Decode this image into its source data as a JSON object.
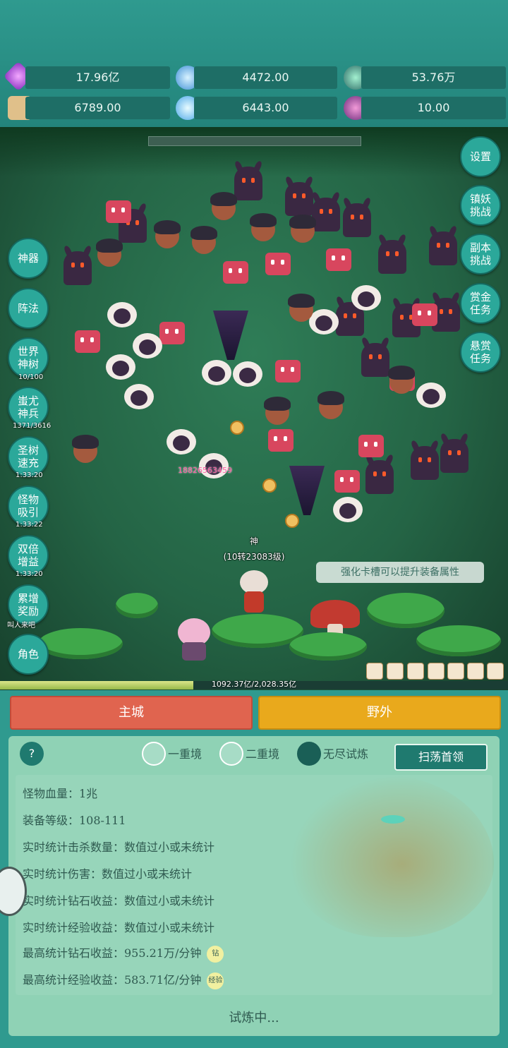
{
  "resources": [
    {
      "icon": "purple-gem-icon",
      "value": "17.96亿"
    },
    {
      "icon": "blue-crystal-icon",
      "value": "4472.00"
    },
    {
      "icon": "green-orb-icon",
      "value": "53.76万"
    },
    {
      "icon": "scroll-icon",
      "value": "6789.00"
    },
    {
      "icon": "ice-crystal-icon",
      "value": "6443.00"
    },
    {
      "icon": "purple-pouch-icon",
      "value": "10.00"
    }
  ],
  "left_menu": [
    {
      "label": "神器",
      "sub": ""
    },
    {
      "label": "阵法",
      "sub": ""
    },
    {
      "label": "世界神树",
      "sub": "10/100"
    },
    {
      "label": "蚩尤神兵",
      "sub": "1371/3616"
    },
    {
      "label": "圣树速充",
      "sub": "1:33:20"
    },
    {
      "label": "怪物吸引",
      "sub": "1:33:22"
    },
    {
      "label": "双倍增益",
      "sub": "1:33:20"
    },
    {
      "label": "累增奖励",
      "sub": "叫人来吧"
    },
    {
      "label": "角色",
      "sub": ""
    }
  ],
  "right_menu": [
    {
      "label": "设置"
    },
    {
      "label": "镇妖挑战"
    },
    {
      "label": "副本挑战"
    },
    {
      "label": "赏金任务"
    },
    {
      "label": "悬赏任务"
    }
  ],
  "battle": {
    "damage_text": "18826563459",
    "hero_name": "神",
    "hero_level": "(10转23083级)",
    "hint": "强化卡槽可以提升装备属性",
    "boss_hp": "1092.37亿/2,028.35亿"
  },
  "nav": {
    "main_city": "主城",
    "wild": "野外"
  },
  "panel": {
    "help": "?",
    "modes": [
      "一重境",
      "二重境",
      "无尽试炼"
    ],
    "selected_mode": "无尽试炼",
    "sweep_label": "扫荡首领",
    "stats": [
      {
        "text": "怪物血量：1兆",
        "tag": ""
      },
      {
        "text": "装备等级：108-111",
        "tag": ""
      },
      {
        "text": "实时统计击杀数量：数值过小或未统计",
        "tag": ""
      },
      {
        "text": "实时统计伤害：数值过小或未统计",
        "tag": ""
      },
      {
        "text": "实时统计钻石收益：数值过小或未统计",
        "tag": ""
      },
      {
        "text": "实时统计经验收益：数值过小或未统计",
        "tag": ""
      },
      {
        "text": "最高统计钻石收益：955.21万/分钟",
        "tag": "钻"
      },
      {
        "text": "最高统计经验收益：583.71亿/分钟",
        "tag": "经验"
      }
    ],
    "status": "试炼中..."
  },
  "colors": {
    "main_city_btn": "#e0644f",
    "wild_btn": "#e9a91c",
    "panel": "#8fd2b5",
    "accent": "#1f7a6f"
  }
}
